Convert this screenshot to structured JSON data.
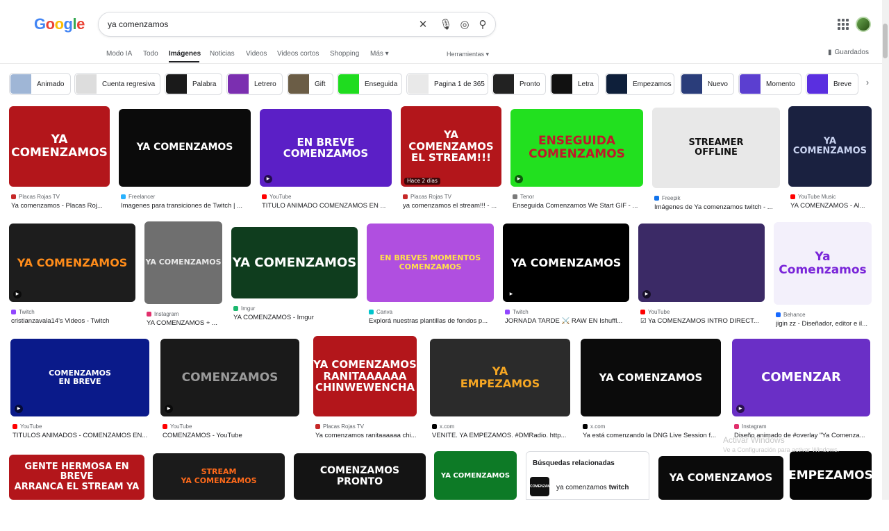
{
  "header": {
    "logo": [
      "G",
      "o",
      "o",
      "g",
      "l",
      "e"
    ],
    "logo_colors": [
      "#4285f4",
      "#ea4335",
      "#fbbc05",
      "#4285f4",
      "#34a853",
      "#ea4335"
    ],
    "search_value": "ya comenzamos",
    "saved_label": "Guardados"
  },
  "icons": {
    "clear": "✕",
    "mic": "🎙",
    "lens": "◎",
    "search": "⚲",
    "chevron": "›",
    "bookmark": "▮",
    "play": "▶"
  },
  "tabs": [
    "Modo IA",
    "Todo",
    "Imágenes",
    "Noticias",
    "Videos",
    "Videos cortos",
    "Shopping",
    "Más ▾"
  ],
  "tools": "Herramientas ▾",
  "chips": [
    {
      "label": "Animado",
      "color": "#9fb6d6"
    },
    {
      "label": "Cuenta regresiva",
      "color": "#dddddd"
    },
    {
      "label": "Palabra",
      "color": "#1a1a1a"
    },
    {
      "label": "Letrero",
      "color": "#7b2fb0"
    },
    {
      "label": "Gift",
      "color": "#6b5d46"
    },
    {
      "label": "Enseguida",
      "color": "#1fdc1f"
    },
    {
      "label": "Pagina 1 de 365",
      "color": "#e9e9e9"
    },
    {
      "label": "Pronto",
      "color": "#222222"
    },
    {
      "label": "Letra",
      "color": "#111111"
    },
    {
      "label": "Empezamos",
      "color": "#0e1f3a"
    },
    {
      "label": "Nuevo",
      "color": "#2a3d7a"
    },
    {
      "label": "Momento",
      "color": "#5b3fd0"
    },
    {
      "label": "Breve",
      "color": "#5a2fe0"
    }
  ],
  "results": [
    {
      "img_text": "YA\nCOMENZAMOS",
      "bg": "#b3161b",
      "fg": "#ffffff",
      "source": "Placas Rojas TV",
      "src_color": "#c62828",
      "title": "Ya comenzamos - Placas Roj...",
      "play": false,
      "badge": ""
    },
    {
      "img_text": "YA COMENZAMOS",
      "bg": "#0b0b0b",
      "fg": "#ffffff",
      "source": "Freelancer",
      "src_color": "#29b2fe",
      "title": "Imagenes para transiciones de Twitch | ...",
      "play": false,
      "badge": ""
    },
    {
      "img_text": "EN BREVE\nCOMENZAMOS",
      "bg": "#5b1fc6",
      "fg": "#ffffff",
      "source": "YouTube",
      "src_color": "#ff0000",
      "title": "TITULO ANIMADO COMENZAMOS EN ...",
      "play": true,
      "badge": ""
    },
    {
      "img_text": "YA COMENZAMOS\nEL STREAM!!!",
      "bg": "#b3161b",
      "fg": "#ffffff",
      "source": "Placas Rojas TV",
      "src_color": "#c62828",
      "title": "ya comenzamos el stream!!! - ...",
      "play": false,
      "badge": "Hace 2 días"
    },
    {
      "img_text": "ENSEGUIDA\nCOMENZAMOS",
      "bg": "#22e01f",
      "fg": "#c0182a",
      "source": "Tenor",
      "src_color": "#7a7a7a",
      "title": "Enseguida Comenzamos We Start GIF - ...",
      "play": true,
      "badge": ""
    },
    {
      "img_text": "STREAMER\nOFFLINE",
      "bg": "#e8e8e8",
      "fg": "#111111",
      "source": "Freepik",
      "src_color": "#1273eb",
      "title": "Imágenes de Ya comenzamos twitch - ...",
      "play": false,
      "badge": ""
    },
    {
      "img_text": "YA COMENZAMOS",
      "bg": "#1a2140",
      "fg": "#c9d3f0",
      "source": "YouTube Music",
      "src_color": "#ff0000",
      "title": "YA COMENZAMOS - Al...",
      "play": false,
      "badge": ""
    },
    {
      "img_text": "YA COMENZAMOS",
      "bg": "#1d1d1d",
      "fg": "#ff8c1a",
      "source": "Twitch",
      "src_color": "#9146ff",
      "title": "cristianzavala14's Videos - Twitch",
      "play": true,
      "badge": ""
    },
    {
      "img_text": "YA COMENZAMOS",
      "bg": "#6f6f6f",
      "fg": "#e8e8e8",
      "source": "Instagram",
      "src_color": "#e1306c",
      "title": "YA COMENZAMOS + ...",
      "play": false,
      "badge": ""
    },
    {
      "img_text": "YA COMENZAMOS",
      "bg": "#0f3d1e",
      "fg": "#ffffff",
      "source": "Imgur",
      "src_color": "#1bb76e",
      "title": "YA COMENZAMOS - Imgur",
      "play": false,
      "badge": ""
    },
    {
      "img_text": "EN BREVES MOMENTOS\nCOMENZAMOS",
      "bg": "#b04fe0",
      "fg": "#ffe14a",
      "source": "Canva",
      "src_color": "#00c4cc",
      "title": "Explorá nuestras plantillas de fondos p...",
      "play": false,
      "badge": ""
    },
    {
      "img_text": "YA COMENZAMOS",
      "bg": "#000000",
      "fg": "#ffffff",
      "source": "Twitch",
      "src_color": "#9146ff",
      "title": "JORNADA TARDE ⚔️ RAW EN Ishuffl...",
      "play": true,
      "badge": ""
    },
    {
      "img_text": "",
      "bg": "#3b2a66",
      "fg": "#ffffff",
      "source": "YouTube",
      "src_color": "#ff0000",
      "title": "☑ Ya COMENZAMOS INTRO DIRECT...",
      "play": true,
      "badge": ""
    },
    {
      "img_text": "Ya\nComenzamos",
      "bg": "#f3f0fb",
      "fg": "#7a26d9",
      "source": "Behance",
      "src_color": "#1769ff",
      "title": "jigin zz - Diseñador, editor e il...",
      "play": false,
      "badge": ""
    },
    {
      "img_text": "COMENZAMOS\nEN BREVE",
      "bg": "#0a1a8a",
      "fg": "#ffffff",
      "source": "YouTube",
      "src_color": "#ff0000",
      "title": "TITULOS ANIMADOS - COMENZAMOS EN...",
      "play": true,
      "badge": ""
    },
    {
      "img_text": "COMENZAMOS",
      "bg": "#1a1a1a",
      "fg": "#9a9a9a",
      "source": "YouTube",
      "src_color": "#ff0000",
      "title": "COMENZAMOS - YouTube",
      "play": true,
      "badge": ""
    },
    {
      "img_text": "YA COMENZAMOS\nRANITAAAAAA\nCHINWEWENCHA",
      "bg": "#b3161b",
      "fg": "#ffffff",
      "source": "Placas Rojas TV",
      "src_color": "#c62828",
      "title": "Ya comenzamos ranitaaaaaa chi...",
      "play": false,
      "badge": ""
    },
    {
      "img_text": "YA\nEMPEZAMOS",
      "bg": "#2b2b2b",
      "fg": "#f5a623",
      "source": "x.com",
      "src_color": "#000000",
      "title": "VENITE. YA EMPEZAMOS. #DMRadio. http...",
      "play": false,
      "badge": ""
    },
    {
      "img_text": "YA COMENZAMOS",
      "bg": "#0b0b0b",
      "fg": "#ffffff",
      "source": "x.com",
      "src_color": "#000000",
      "title": "Ya está comenzando la DNG Live Session f...",
      "play": false,
      "badge": ""
    },
    {
      "img_text": "COMENZAR",
      "bg": "#6a2fc6",
      "fg": "#ffffff",
      "source": "Instagram",
      "src_color": "#e1306c",
      "title": "Diseño animado de #overlay \"Ya Comenza...",
      "play": true,
      "badge": ""
    },
    {
      "img_text": "GENTE HERMOSA EN BREVE\nARRANCA EL STREAM YA",
      "bg": "#b3161b",
      "fg": "#ffffff",
      "source": "",
      "src_color": "#c62828",
      "title": "",
      "play": false,
      "badge": ""
    },
    {
      "img_text": "STREAM\nYA COMENZAMOS",
      "bg": "#1b1b1b",
      "fg": "#ff6a1a",
      "source": "",
      "src_color": "#000",
      "title": "",
      "play": false,
      "badge": ""
    },
    {
      "img_text": "COMENZAMOS\nPRONTO",
      "bg": "#141414",
      "fg": "#ffffff",
      "source": "",
      "src_color": "#000",
      "title": "",
      "play": false,
      "badge": ""
    },
    {
      "img_text": "YA COMENZAMOS",
      "bg": "#0d7a26",
      "fg": "#ffffff",
      "source": "",
      "src_color": "#000",
      "title": "",
      "play": false,
      "badge": ""
    },
    {
      "img_text": "YA COMENZAMOS",
      "bg": "#0b0b0b",
      "fg": "#ffffff",
      "source": "",
      "src_color": "#000",
      "title": "",
      "play": false,
      "badge": ""
    },
    {
      "img_text": "EMPEZAMOS",
      "bg": "#050505",
      "fg": "#ffffff",
      "source": "",
      "src_color": "#000",
      "title": "",
      "play": false,
      "badge": ""
    }
  ],
  "related": {
    "heading": "Búsquedas relacionadas",
    "query_prefix": "ya comenzamos ",
    "query_bold": "twitch",
    "thumb_text": "COMENZAMOS"
  },
  "watermark": {
    "line1": "Activar Windows",
    "line2": "Ve a Configuración para activar Windows."
  }
}
